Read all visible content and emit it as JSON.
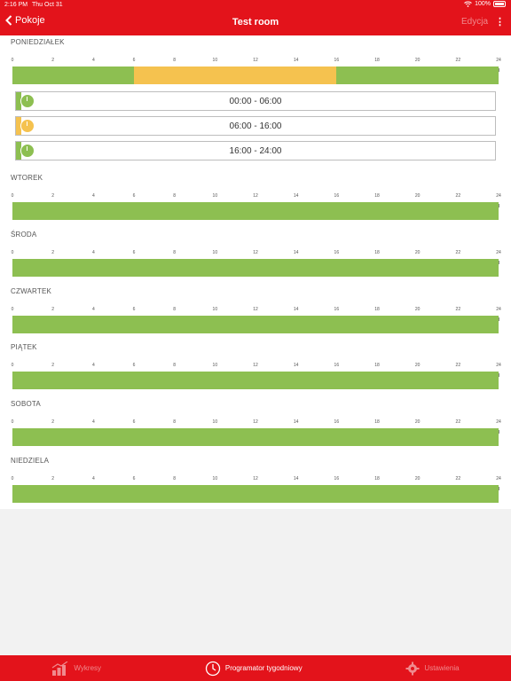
{
  "status_bar": {
    "time": "2:16 PM",
    "date": "Thu Oct 31",
    "battery": "100%"
  },
  "header": {
    "back_label": "Pokoje",
    "title": "Test room",
    "edit_label": "Edycja"
  },
  "axis_labels": [
    "0",
    "2",
    "4",
    "6",
    "8",
    "10",
    "12",
    "14",
    "16",
    "18",
    "20",
    "22",
    "24"
  ],
  "colors": {
    "accent": "#e3131b",
    "comfort": "#8dbf51",
    "eco": "#f5c24f"
  },
  "days": [
    {
      "label": "PONIEDZIAŁEK",
      "segments": [
        {
          "from": 0,
          "to": 6,
          "color": "#8dbf51"
        },
        {
          "from": 6,
          "to": 16,
          "color": "#f5c24f"
        },
        {
          "from": 16,
          "to": 24,
          "color": "#8dbf51"
        }
      ]
    },
    {
      "label": "WTOREK",
      "segments": [
        {
          "from": 0,
          "to": 24,
          "color": "#8dbf51"
        }
      ]
    },
    {
      "label": "ŚRODA",
      "segments": [
        {
          "from": 0,
          "to": 24,
          "color": "#8dbf51"
        }
      ]
    },
    {
      "label": "CZWARTEK",
      "segments": [
        {
          "from": 0,
          "to": 24,
          "color": "#8dbf51"
        }
      ]
    },
    {
      "label": "PIĄTEK",
      "segments": [
        {
          "from": 0,
          "to": 24,
          "color": "#8dbf51"
        }
      ]
    },
    {
      "label": "SOBOTA",
      "segments": [
        {
          "from": 0,
          "to": 24,
          "color": "#8dbf51"
        }
      ]
    },
    {
      "label": "NIEDZIELA",
      "segments": [
        {
          "from": 0,
          "to": 24,
          "color": "#8dbf51"
        }
      ]
    }
  ],
  "time_slots": [
    {
      "label": "00:00 - 06:00",
      "color": "#8dbf51"
    },
    {
      "label": "06:00 - 16:00",
      "color": "#f5c24f"
    },
    {
      "label": "16:00 - 24:00",
      "color": "#8dbf51"
    }
  ],
  "tabs": [
    {
      "label": "Wykresy",
      "icon": "bar-chart-icon",
      "active": false
    },
    {
      "label": "Programator tygodniowy",
      "icon": "clock-icon",
      "active": true
    },
    {
      "label": "Ustawienia",
      "icon": "gear-icon",
      "active": false
    }
  ]
}
